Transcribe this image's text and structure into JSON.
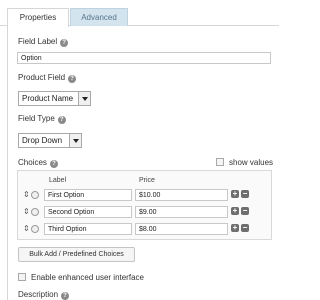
{
  "tabs": [
    {
      "label": "Properties",
      "active": true
    },
    {
      "label": "Advanced",
      "active": false
    }
  ],
  "field_label": {
    "label": "Field Label",
    "value": "Option"
  },
  "product_field": {
    "label": "Product Field",
    "selected": "Product Name"
  },
  "field_type": {
    "label": "Field Type",
    "selected": "Drop Down"
  },
  "choices": {
    "label": "Choices",
    "show_values_label": "show values",
    "columns": {
      "label": "Label",
      "price": "Price"
    },
    "rows": [
      {
        "label": "First Option",
        "price": "$10.00"
      },
      {
        "label": "Second Option",
        "price": "$9.00"
      },
      {
        "label": "Third Option",
        "price": "$8.00"
      }
    ],
    "bulk_button": "Bulk Add / Predefined Choices"
  },
  "enhanced_ui": {
    "label": "Enable enhanced user interface"
  },
  "description": {
    "label": "Description"
  },
  "icons": {
    "help": "help-icon",
    "sort": "sort-arrows-icon",
    "add": "plus-icon",
    "remove": "minus-icon",
    "dropdown": "chevron-down-icon"
  },
  "colors": {
    "inactive_tab_bg": "#d3e4ef",
    "inactive_tab_text": "#55748a",
    "icon_gray": "#8a8a8a"
  }
}
